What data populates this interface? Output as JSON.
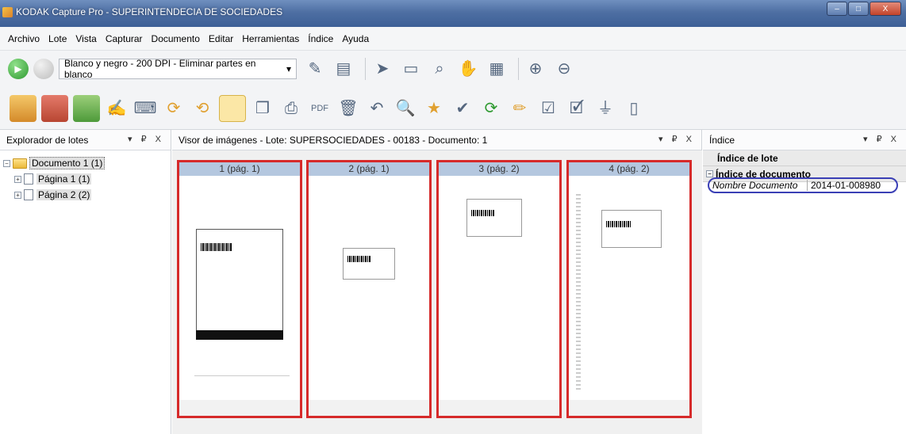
{
  "window": {
    "title": "KODAK Capture Pro - SUPERINTENDECIA DE SOCIEDADES",
    "controls": [
      "–",
      "□",
      "X"
    ]
  },
  "menu": [
    "Archivo",
    "Lote",
    "Vista",
    "Capturar",
    "Documento",
    "Editar",
    "Herramientas",
    "Índice",
    "Ayuda"
  ],
  "toolbar": {
    "profile": "Blanco y negro - 200 DPI - Eliminar partes en blanco"
  },
  "explorer": {
    "title": "Explorador de lotes",
    "items": [
      {
        "label": "Documento 1 (1)"
      },
      {
        "label": "Página 1 (1)"
      },
      {
        "label": "Página 2 (2)"
      }
    ]
  },
  "viewer": {
    "title": "Visor de imágenes - Lote: SUPERSOCIEDADES - 00183 - Documento: 1",
    "thumbnails": [
      {
        "label": "1 (pág. 1)"
      },
      {
        "label": "2 (pág. 1)"
      },
      {
        "label": "3 (pág. 2)"
      },
      {
        "label": "4 (pág. 2)"
      }
    ]
  },
  "index": {
    "title": "Índice",
    "batch_index": "Índice de lote",
    "doc_index": "Índice de documento",
    "field_label": "Nombre Documento",
    "field_value": "2014-01-008980"
  },
  "panel_controls": "▾ ₽ X",
  "colors": {
    "highlight_border": "#d62a2a",
    "title_gradient": "#4e6fa3",
    "field_outline": "#3a3fb5"
  }
}
